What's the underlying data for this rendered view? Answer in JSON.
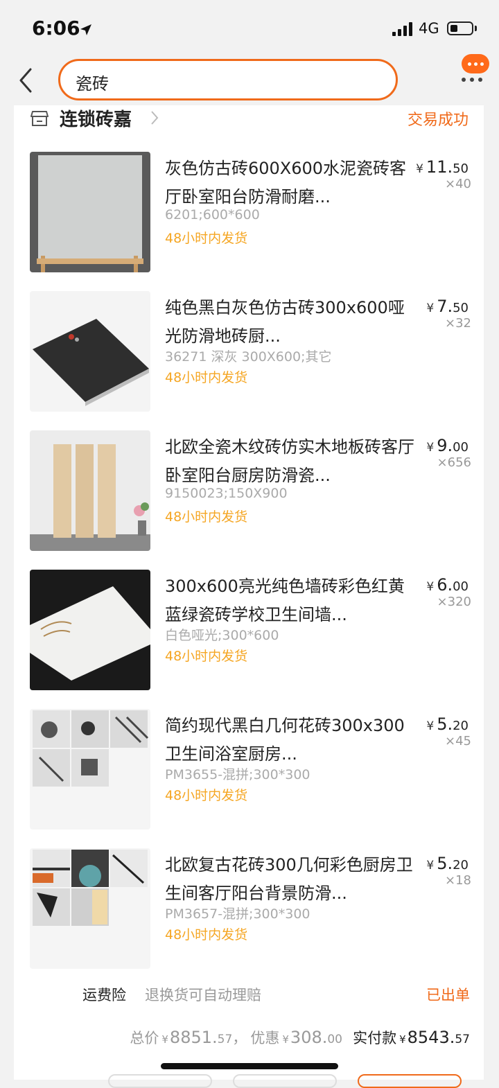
{
  "status_bar": {
    "time": "6:06",
    "network": "4G"
  },
  "search": {
    "query": "瓷砖"
  },
  "shop": {
    "name": "连锁砖嘉",
    "order_status": "交易成功"
  },
  "items": [
    {
      "title": "灰色仿古砖600X600水泥瓷砖客厅卧室阳台防滑耐磨...",
      "sku": "6201;600*600",
      "shipping": "48小时内发货",
      "currency": "¥",
      "price_int": "11.",
      "price_dec": "50",
      "qty": "×40"
    },
    {
      "title": "纯色黑白灰色仿古砖300x600哑光防滑地砖厨...",
      "sku": "36271 深灰 300X600;其它",
      "shipping": "48小时内发货",
      "currency": "¥",
      "price_int": "7.",
      "price_dec": "50",
      "qty": "×32"
    },
    {
      "title": "北欧全瓷木纹砖仿实木地板砖客厅卧室阳台厨房防滑瓷...",
      "sku": "9150023;150X900",
      "shipping": "48小时内发货",
      "currency": "¥",
      "price_int": "9.",
      "price_dec": "00",
      "qty": "×656"
    },
    {
      "title": "300x600亮光纯色墙砖彩色红黄蓝绿瓷砖学校卫生间墙...",
      "sku": "白色哑光;300*600",
      "shipping": "48小时内发货",
      "currency": "¥",
      "price_int": "6.",
      "price_dec": "00",
      "qty": "×320"
    },
    {
      "title": "简约现代黑白几何花砖300x300卫生间浴室厨房...",
      "sku": "PM3655-混拼;300*300",
      "shipping": "48小时内发货",
      "currency": "¥",
      "price_int": "5.",
      "price_dec": "20",
      "qty": "×45"
    },
    {
      "title": "北欧复古花砖300几何彩色厨房卫生间客厅阳台背景防滑...",
      "sku": "PM3657-混拼;300*300",
      "shipping": "48小时内发货",
      "currency": "¥",
      "price_int": "5.",
      "price_dec": "20",
      "qty": "×18"
    }
  ],
  "insurance": {
    "label": "运费险",
    "desc": "退换货可自动理赔",
    "status": "已出单"
  },
  "totals": {
    "total_label": "总价",
    "total_currency": "¥",
    "total_int": "8851.",
    "total_dec": "57",
    "separator": "，",
    "discount_label": "优惠",
    "discount_currency": "¥",
    "discount_int": "308.",
    "discount_dec": "00",
    "paid_label": "实付款",
    "paid_currency": "¥",
    "paid_int": "8543.",
    "paid_dec": "57"
  },
  "colors": {
    "accent": "#f06a1a",
    "shipping": "#f5a623",
    "muted": "#999999"
  },
  "icons": [
    "location-arrow-icon",
    "signal-icon",
    "battery-icon",
    "back-chevron-icon",
    "more-icon",
    "shop-icon",
    "chevron-right-icon"
  ]
}
